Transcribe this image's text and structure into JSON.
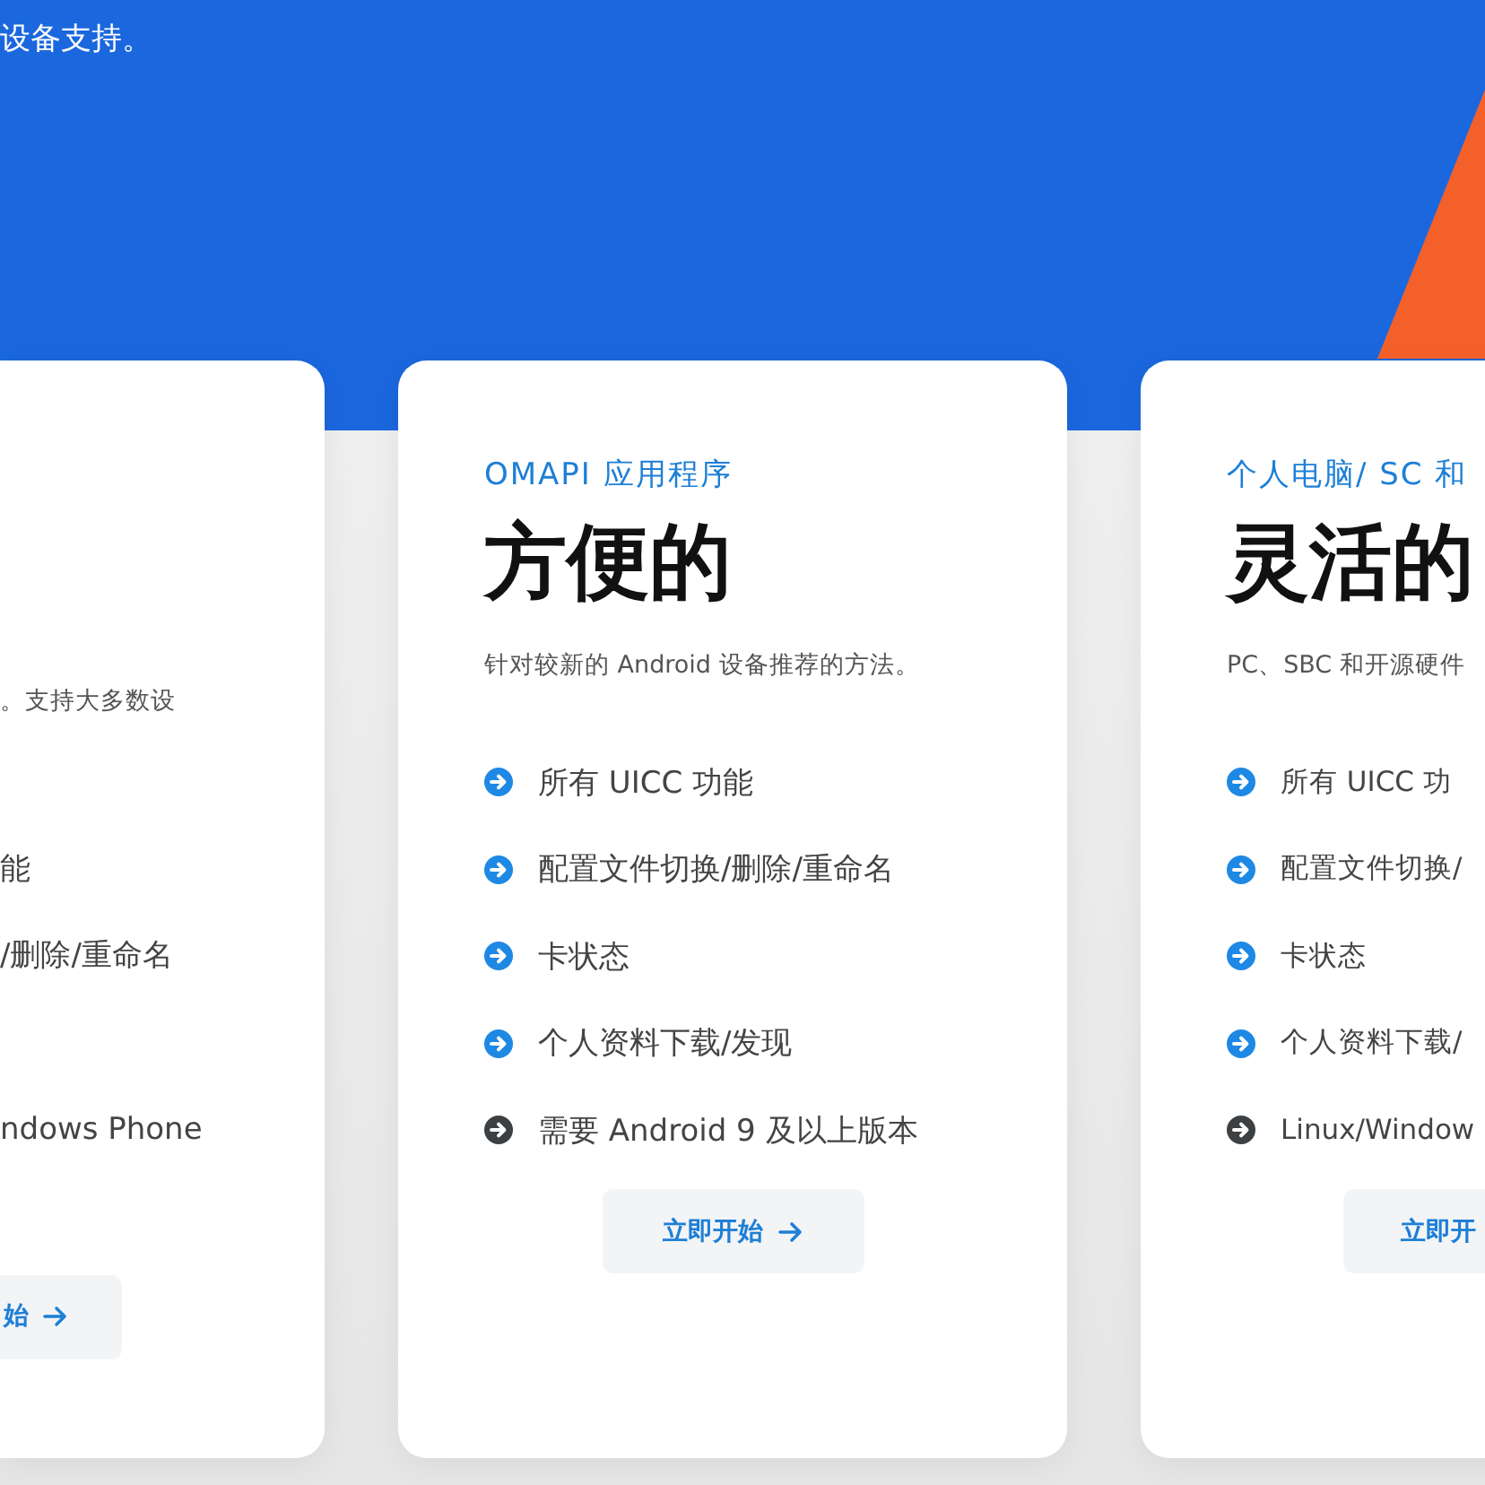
{
  "header": {
    "text": "设备支持。"
  },
  "cards": [
    {
      "description": "。支持大多数设",
      "features": [
        {
          "text": "能"
        },
        {
          "text": "/删除/重命名"
        },
        {
          "text": "ndows Phone"
        }
      ],
      "button": "始",
      "button_arrow": true
    },
    {
      "subtitle": "OMAPI 应用程序",
      "title": "方便的",
      "description": "针对较新的 Android 设备推荐的方法。",
      "features": [
        {
          "text": "所有 UICC 功能",
          "color": "#1e88e5"
        },
        {
          "text": "配置文件切换/删除/重命名",
          "color": "#1e88e5"
        },
        {
          "text": "卡状态",
          "color": "#1e88e5"
        },
        {
          "text": "个人资料下载/发现",
          "color": "#1e88e5"
        },
        {
          "text": "需要 Android 9 及以上版本",
          "color": "#3c4043"
        }
      ],
      "button": "立即开始",
      "button_arrow": true
    },
    {
      "subtitle": "个人电脑/ SC 和",
      "title": "灵活的",
      "description": "PC、SBC 和开源硬件",
      "features": [
        {
          "text": "所有 UICC 功",
          "color": "#1e88e5"
        },
        {
          "text": "配置文件切换/",
          "color": "#1e88e5"
        },
        {
          "text": "卡状态",
          "color": "#1e88e5"
        },
        {
          "text": "个人资料下载/",
          "color": "#1e88e5"
        },
        {
          "text": "Linux/Window",
          "color": "#3c4043"
        }
      ],
      "button": "立即开"
    }
  ]
}
